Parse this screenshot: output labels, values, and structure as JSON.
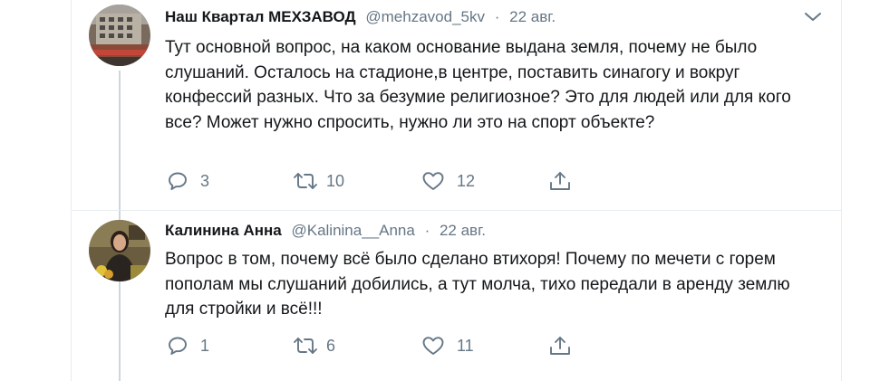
{
  "tweets": [
    {
      "display_name": "Наш Квартал МЕХЗАВОД",
      "handle": "@mehzavod_5kv",
      "separator": "·",
      "date": "22 авг.",
      "text": "Тут основной вопрос, на каком основание выдана земля, почему не было слушаний. Осталось на стадионе,в центре, поставить синагогу и вокруг конфессий разных. Что за безумие религиозное? Это для людей или для кого все? Может нужно спросить, нужно ли это на спорт объекте?",
      "replies": "3",
      "retweets": "10",
      "likes": "12"
    },
    {
      "display_name": "Калинина Анна",
      "handle": "@Kalinina__Anna",
      "separator": "·",
      "date": "22 авг.",
      "text": "Вопрос в том, почему всё было сделано втихоря! Почему по мечети с горем пополам мы слушаний добились, а тут молча, тихо передали в аренду землю для стройки и всё!!!",
      "replies": "1",
      "retweets": "6",
      "likes": "11"
    }
  ],
  "icons": {
    "reply": "reply-icon",
    "retweet": "retweet-icon",
    "like": "heart-icon",
    "share": "share-icon",
    "more": "chevron-down-icon"
  },
  "colors": {
    "text": "#14171a",
    "secondary": "#657786",
    "border": "#e6ecf0",
    "thread_line": "#ccd6dd"
  }
}
